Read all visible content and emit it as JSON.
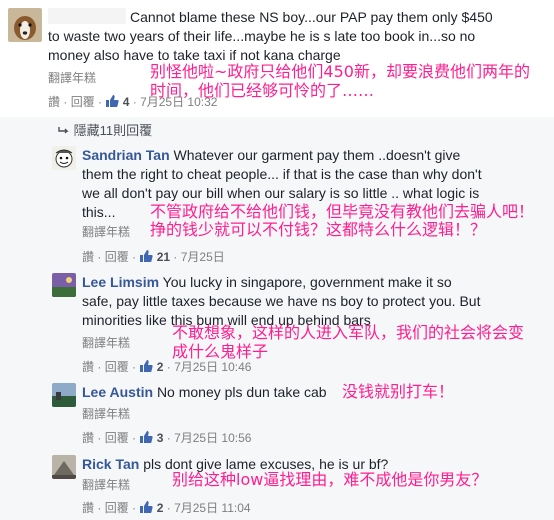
{
  "top_comment": {
    "author": "",
    "text_lines": [
      "Cannot blame these NS boy...our PAP pay them only $450",
      "to waste two years of their life...maybe he is s late too book in...so no",
      "money also have to take taxi if not kana charge"
    ],
    "translate": "翻譯年糕",
    "like": "讚",
    "reply": "回覆",
    "reactions": "4",
    "time": "7月25日 10:32",
    "annotation": [
      "别怪他啦~政府只给他们450新，却要浪费他们两年的",
      "时间，他们已经够可怜的了……"
    ]
  },
  "hidden_replies": "隱藏11則回覆",
  "replies": [
    {
      "author": "Sandrian Tan",
      "text_lines": [
        "Whatever our garment pay them ..doesn't give",
        "them the right to cheat people... if that is the case than why don't",
        "we all don't pay our bill when our salary is so little .. what logic is",
        "this..."
      ],
      "translate": "翻譯年糕",
      "like": "讚",
      "reply": "回覆",
      "reactions": "21",
      "time": "7月25日",
      "annotation": [
        "不管政府给不给他们钱，但毕竟没有教他们去骗人吧！",
        "挣的钱少就可以不付钱？这都特么什么逻辑！？"
      ]
    },
    {
      "author": "Lee Limsim",
      "text_lines": [
        "You lucky in singapore, government make it so",
        "safe, pay little taxes because we have ns boy to protect you. But",
        "minorities like this bum will end up behind bars"
      ],
      "translate": "翻譯年糕",
      "like": "讚",
      "reply": "回覆",
      "reactions": "2",
      "time": "7月25日 10:46",
      "annotation": [
        "不敢想象，这样的人进入军队，我们的社会将会变",
        "成什么鬼样子"
      ]
    },
    {
      "author": "Lee Austin",
      "text_lines": [
        "No money pls dun take cab"
      ],
      "translate": "翻譯年糕",
      "like": "讚",
      "reply": "回覆",
      "reactions": "3",
      "time": "7月25日 10:56",
      "annotation": [
        "没钱就别打车！"
      ]
    },
    {
      "author": "Rick Tan",
      "text_lines": [
        "pls dont give lame excuses, he is ur bf?"
      ],
      "translate": "翻譯年糕",
      "like": "讚",
      "reply": "回覆",
      "reactions": "2",
      "time": "7月25日 11:04",
      "annotation": [
        "别给这种low逼找理由，难不成他是你男友？"
      ]
    }
  ],
  "colors": {
    "name": "#365899",
    "annotation": "#ff1f8f",
    "meta": "#7f7f7f",
    "like_icon": "#4267b2"
  }
}
